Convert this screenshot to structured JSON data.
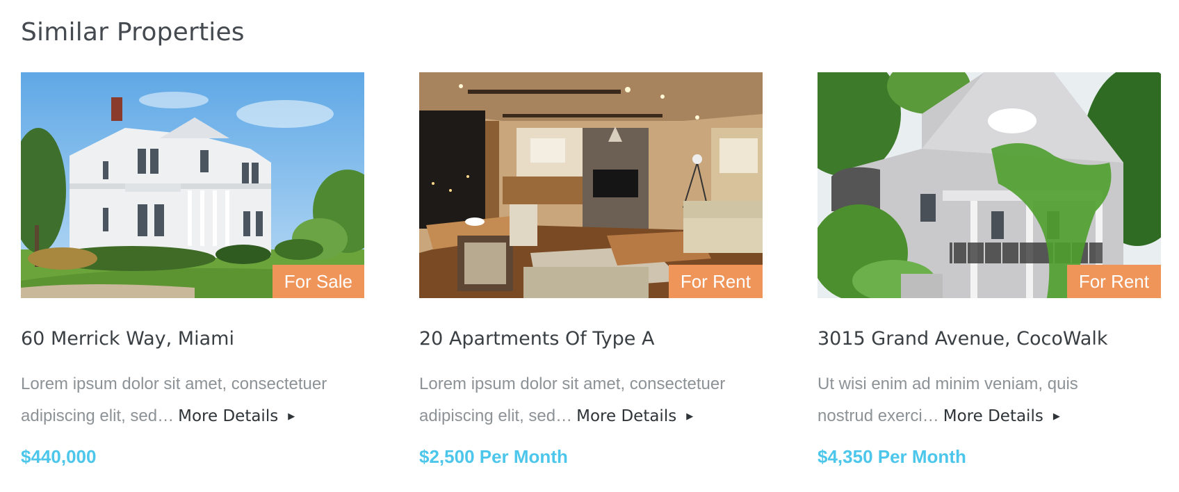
{
  "section": {
    "title": "Similar Properties"
  },
  "colors": {
    "badge": "#f0955a",
    "price": "#4cc6ea",
    "title": "#3a3f44",
    "excerpt": "#8c9296"
  },
  "properties": [
    {
      "badge": "For Sale",
      "title": "60 Merrick Way, Miami",
      "excerpt_line1": "Lorem ipsum dolor sit amet, consectetuer",
      "excerpt_line2": "adipiscing elit, sed…",
      "more": "More Details",
      "price": "$440,000",
      "photo": "white-victorian-house-photo"
    },
    {
      "badge": "For Rent",
      "title": "20 Apartments Of Type A",
      "excerpt_line1": "Lorem ipsum dolor sit amet, consectetuer",
      "excerpt_line2": "adipiscing elit, sed…",
      "more": "More Details",
      "price": "$2,500 Per Month",
      "photo": "living-room-interior-photo"
    },
    {
      "badge": "For Rent",
      "title": "3015 Grand Avenue, CocoWalk",
      "excerpt_line1": "Ut wisi enim ad minim veniam, quis",
      "excerpt_line2": "nostrud exerci…",
      "more": "More Details",
      "price": "$4,350 Per Month",
      "photo": "grey-house-with-ivy-photo"
    }
  ]
}
